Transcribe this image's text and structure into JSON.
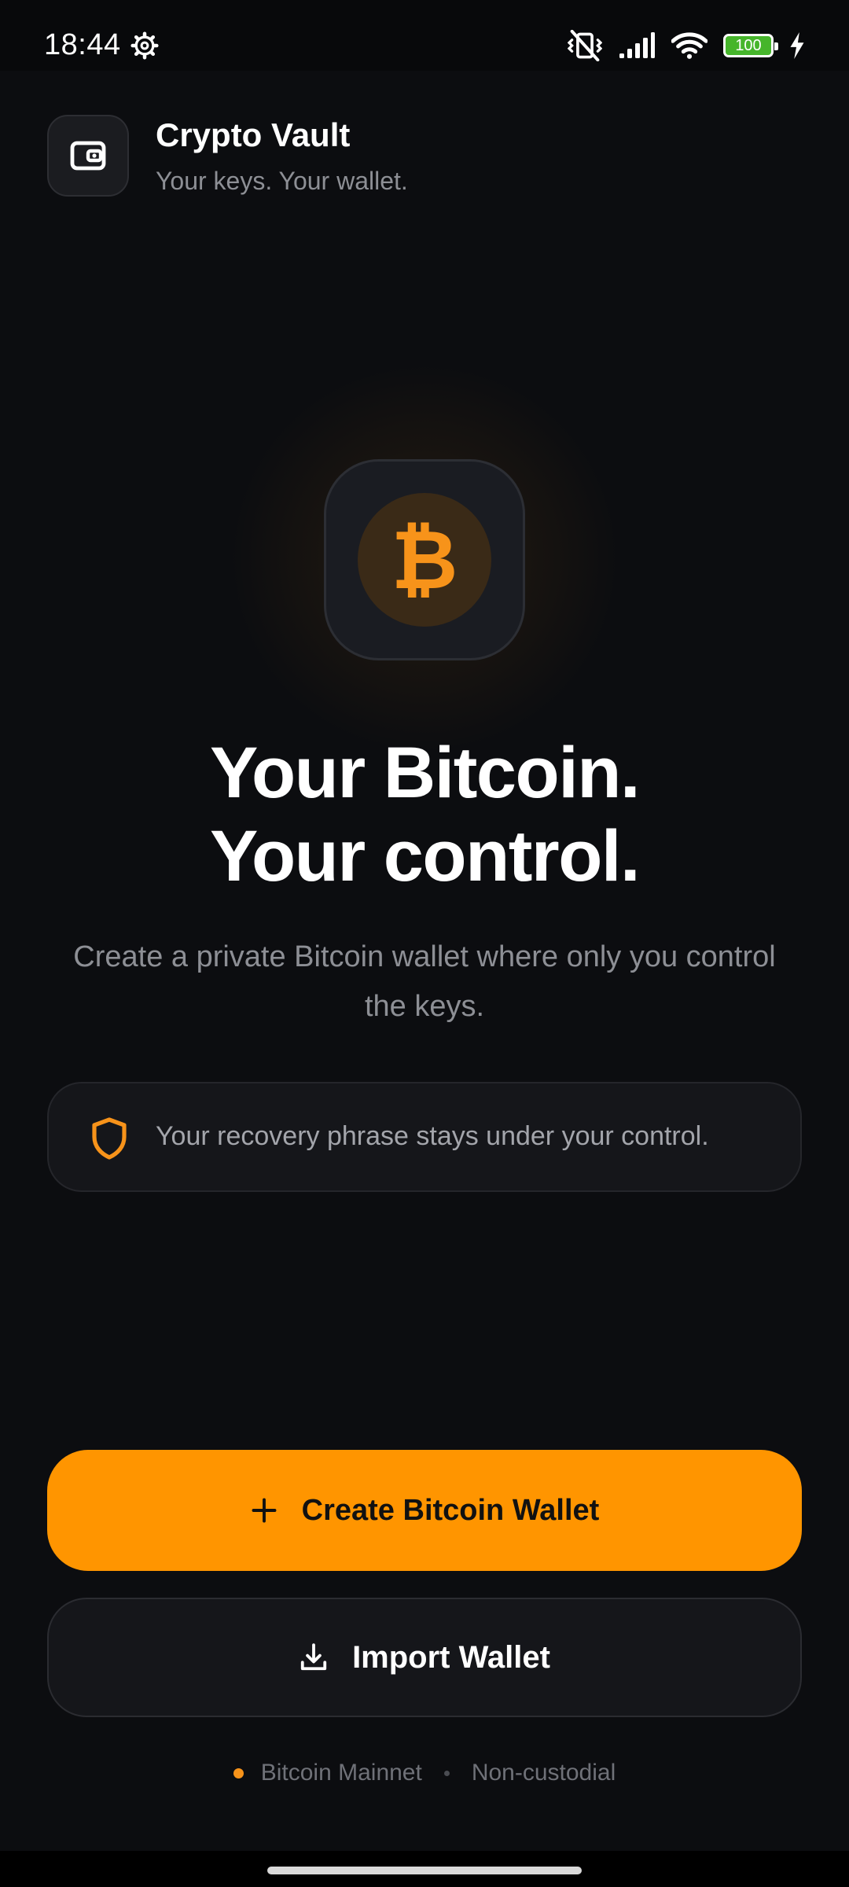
{
  "status_bar": {
    "time": "18:44",
    "battery_level": "100",
    "icons": [
      "settings-gear-icon",
      "vibrate-off-icon",
      "signal-icon",
      "wifi-icon",
      "battery-icon",
      "charging-bolt-icon"
    ]
  },
  "header": {
    "title": "Crypto Vault",
    "subtitle": "Your keys. Your wallet.",
    "logo_icon": "wallet-icon"
  },
  "hero": {
    "symbol": "₿",
    "icon": "bitcoin-icon",
    "headline_line1": "Your Bitcoin.",
    "headline_line2": "Your control.",
    "description": "Create a private Bitcoin wallet where only you control the keys."
  },
  "info_card": {
    "icon": "shield-icon",
    "text": "Your recovery phrase stays under your control."
  },
  "actions": {
    "create_label": "Create Bitcoin Wallet",
    "create_icon": "plus-icon",
    "import_label": "Import Wallet",
    "import_icon": "download-icon"
  },
  "footer": {
    "network": "Bitcoin Mainnet",
    "custody": "Non-custodial"
  },
  "colors": {
    "background": "#0c0d10",
    "accent": "#ff9500",
    "bitcoin_orange": "#f7931a",
    "card": "#15161a",
    "muted_text": "#8d8f95",
    "battery_green": "#46b52b"
  }
}
